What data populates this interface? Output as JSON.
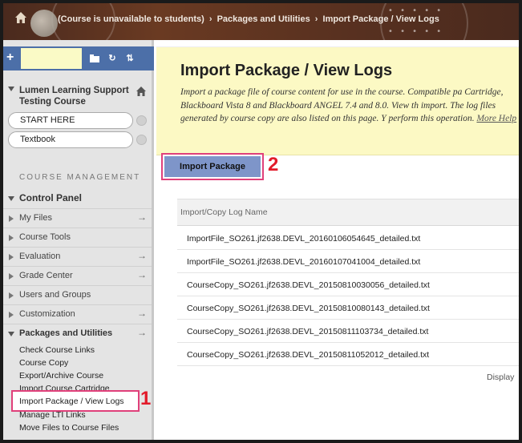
{
  "breadcrumb": {
    "course": "(Course is unavailable to students)",
    "section": "Packages and Utilities",
    "current": "Import Package / View Logs"
  },
  "sidebar": {
    "course_title": "Lumen Learning Support Testing Course",
    "pills": [
      "START HERE",
      "Textbook"
    ],
    "course_management_heading": "COURSE MANAGEMENT",
    "control_panel_heading": "Control Panel",
    "menu_items": [
      {
        "label": "My Files",
        "arrow": "→"
      },
      {
        "label": "Course Tools",
        "arrow": ""
      },
      {
        "label": "Evaluation",
        "arrow": "→"
      },
      {
        "label": "Grade Center",
        "arrow": "→"
      },
      {
        "label": "Users and Groups",
        "arrow": ""
      },
      {
        "label": "Customization",
        "arrow": "→"
      }
    ],
    "packages_heading": "Packages and Utilities",
    "packages_arrow": "→",
    "sub_items": [
      "Check Course Links",
      "Course Copy",
      "Export/Archive Course",
      "Import Course Cartridge",
      "Import Package / View Logs",
      "Manage LTI Links",
      "Move Files to Course Files"
    ]
  },
  "main": {
    "title": "Import Package / View Logs",
    "description": "Import a package file of course content for use in the course. Compatible pa Cartridge, Blackboard Vista 8 and Blackboard ANGEL 7.4 and 8.0. View th import. The log files generated by course copy are also listed on this page. Y perform this operation.",
    "more_help": "More Help",
    "import_button": "Import Package",
    "logs_column_header": "Import/Copy Log Name",
    "logs": [
      "ImportFile_SO261.jf2638.DEVL_20160106054645_detailed.txt",
      "ImportFile_SO261.jf2638.DEVL_20160107041004_detailed.txt",
      "CourseCopy_SO261.jf2638.DEVL_20150810030056_detailed.txt",
      "CourseCopy_SO261.jf2638.DEVL_20150810080143_detailed.txt",
      "CourseCopy_SO261.jf2638.DEVL_20150811103734_detailed.txt",
      "CourseCopy_SO261.jf2638.DEVL_20150811052012_detailed.txt"
    ],
    "footer_text": "Display"
  },
  "annotations": {
    "step1": "1",
    "step2": "2",
    "highlight_color": "#e0407a",
    "number_color": "#e21b2a"
  },
  "colors": {
    "topbar": "#5b3220",
    "sidebar": "#e4e4e4",
    "toolbar_blue": "#4c6fa8",
    "header_band": "#fcf9c4",
    "button_blue": "#7e95c9"
  }
}
